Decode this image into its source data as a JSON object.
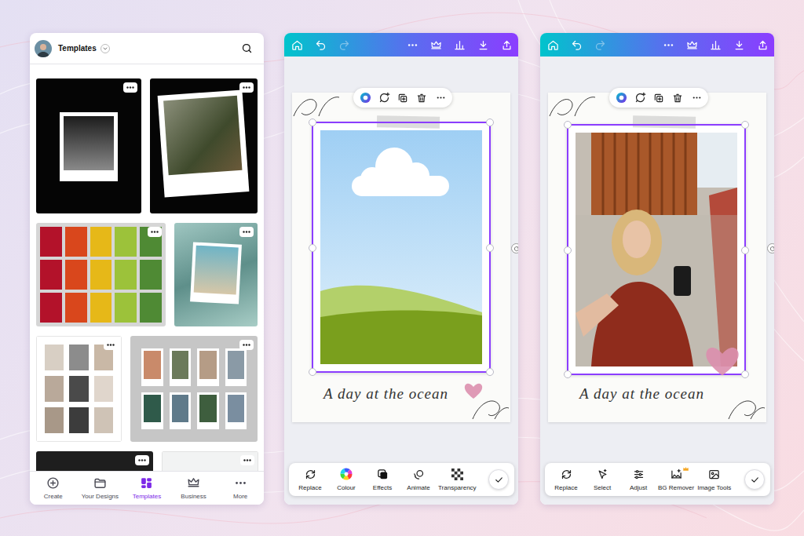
{
  "templates_screen": {
    "title": "Templates",
    "nav": [
      {
        "label": "Create",
        "selected": false
      },
      {
        "label": "Your Designs",
        "selected": false
      },
      {
        "label": "Templates",
        "selected": true
      },
      {
        "label": "Business",
        "selected": false
      },
      {
        "label": "More",
        "selected": false
      }
    ]
  },
  "editors": [
    {
      "kind": "illustration",
      "redo_enabled": false,
      "design_text": "A day at the ocean",
      "tools": [
        {
          "label": "Replace",
          "premium": false
        },
        {
          "label": "Colour",
          "premium": false
        },
        {
          "label": "Effects",
          "premium": false
        },
        {
          "label": "Animate",
          "premium": false
        },
        {
          "label": "Transparency",
          "premium": false
        }
      ]
    },
    {
      "kind": "photo",
      "redo_enabled": false,
      "design_text": "A day at the ocean",
      "tools": [
        {
          "label": "Replace",
          "premium": false
        },
        {
          "label": "Select",
          "premium": false
        },
        {
          "label": "Adjust",
          "premium": false
        },
        {
          "label": "BG Remover",
          "premium": true
        },
        {
          "label": "Image Tools",
          "premium": false
        }
      ]
    }
  ]
}
